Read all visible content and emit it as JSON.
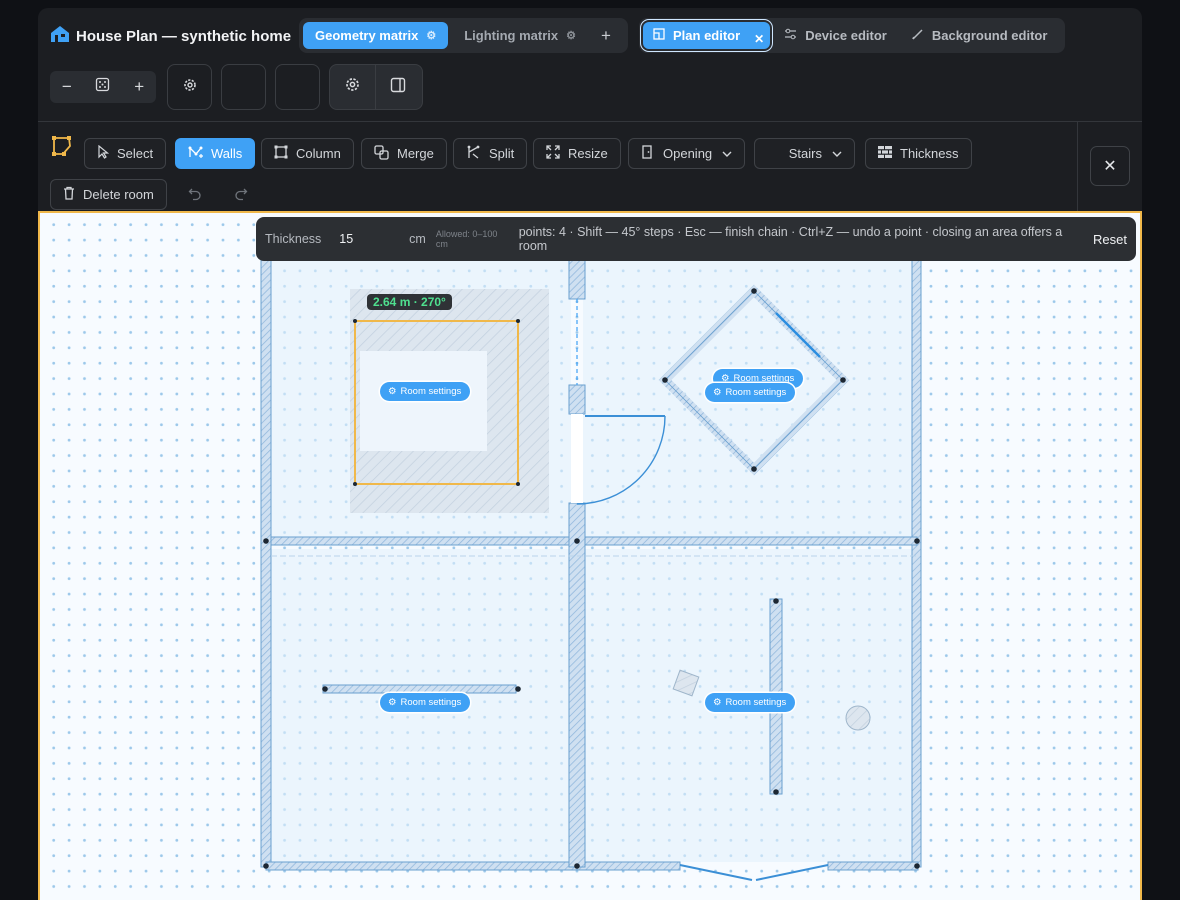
{
  "app": {
    "title": "House Plan — synthetic home",
    "matrix_tabs": [
      {
        "label": "Geometry matrix",
        "active": true
      },
      {
        "label": "Lighting matrix",
        "active": false
      }
    ],
    "editor_tabs": [
      {
        "label": "Plan editor",
        "active": true
      },
      {
        "label": "Device editor",
        "active": false
      },
      {
        "label": "Background editor",
        "active": false
      }
    ]
  },
  "toolbar": {
    "tools": [
      {
        "label": "Select",
        "icon": "pointer-icon",
        "active": false
      },
      {
        "label": "Walls",
        "icon": "walls-icon",
        "active": true
      },
      {
        "label": "Column",
        "icon": "column-icon",
        "active": false
      },
      {
        "label": "Merge",
        "icon": "merge-icon",
        "active": false
      },
      {
        "label": "Split",
        "icon": "split-icon",
        "active": false
      },
      {
        "label": "Resize",
        "icon": "resize-icon",
        "active": false
      },
      {
        "label": "Opening",
        "icon": "door-icon",
        "active": false
      },
      {
        "label": "Stairs",
        "icon": "stairs-icon",
        "active": false
      },
      {
        "label": "Thickness",
        "icon": "bricks-icon",
        "active": false
      }
    ],
    "delete_room": "Delete room"
  },
  "hint": {
    "thickness_label": "Thickness",
    "thickness_value": "15",
    "unit": "cm",
    "allowed": "Allowed: 0–100 cm",
    "instructions": "points: 4 · Shift — 45° steps · Esc — finish chain · Ctrl+Z — undo a point · closing an area offers a room",
    "reset": "Reset"
  },
  "plan": {
    "measurement": "2.64 m · 270°",
    "room_chip_label": "Room settings"
  },
  "colors": {
    "accent": "#3fa1f5",
    "selection": "#f0b84a",
    "wall_fill": "#c9dcef",
    "wall_stroke": "#6aa0cf"
  }
}
